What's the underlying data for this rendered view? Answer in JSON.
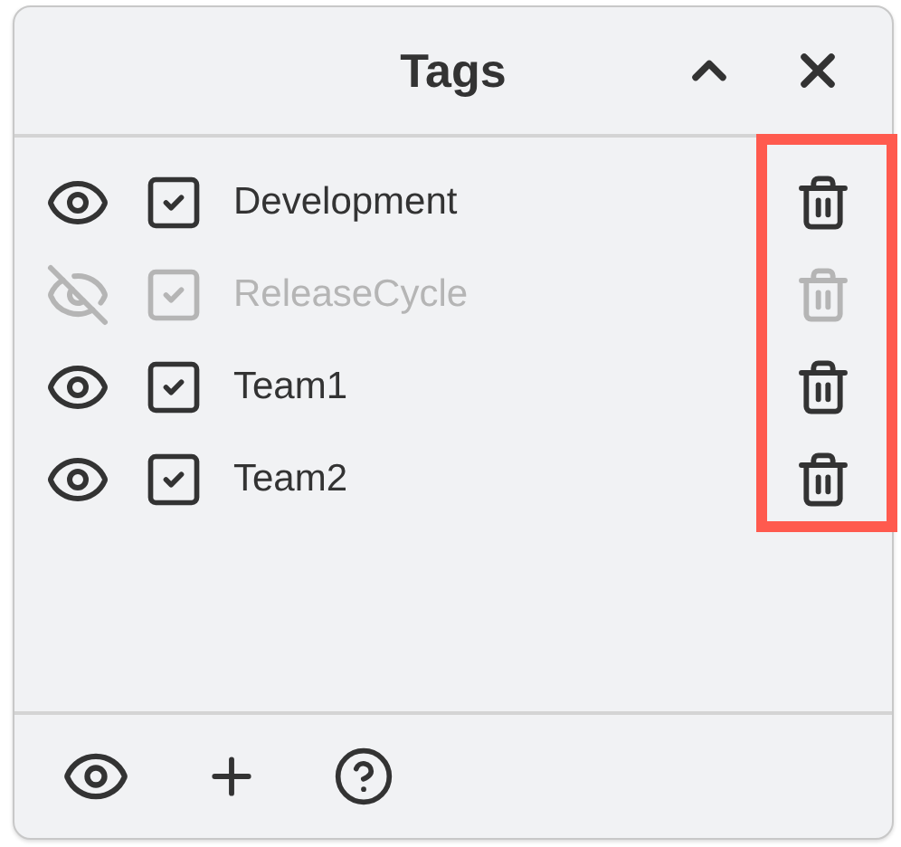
{
  "panel": {
    "title": "Tags"
  },
  "tags": [
    {
      "label": "Development",
      "visible": true,
      "checked": true
    },
    {
      "label": "ReleaseCycle",
      "visible": false,
      "checked": true
    },
    {
      "label": "Team1",
      "visible": true,
      "checked": true
    },
    {
      "label": "Team2",
      "visible": true,
      "checked": true
    }
  ],
  "highlight": {
    "color": "#ff5a4e"
  }
}
